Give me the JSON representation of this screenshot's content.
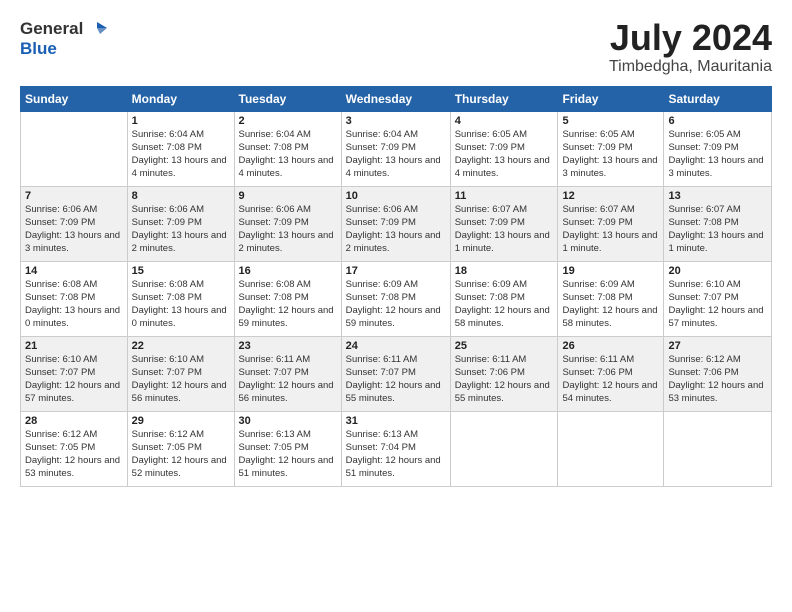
{
  "header": {
    "logo_general": "General",
    "logo_blue": "Blue",
    "month": "July 2024",
    "location": "Timbedgha, Mauritania"
  },
  "weekdays": [
    "Sunday",
    "Monday",
    "Tuesday",
    "Wednesday",
    "Thursday",
    "Friday",
    "Saturday"
  ],
  "weeks": [
    [
      {
        "day": "",
        "sunrise": "",
        "sunset": "",
        "daylight": ""
      },
      {
        "day": "1",
        "sunrise": "6:04 AM",
        "sunset": "7:08 PM",
        "daylight": "13 hours and 4 minutes."
      },
      {
        "day": "2",
        "sunrise": "6:04 AM",
        "sunset": "7:08 PM",
        "daylight": "13 hours and 4 minutes."
      },
      {
        "day": "3",
        "sunrise": "6:04 AM",
        "sunset": "7:09 PM",
        "daylight": "13 hours and 4 minutes."
      },
      {
        "day": "4",
        "sunrise": "6:05 AM",
        "sunset": "7:09 PM",
        "daylight": "13 hours and 4 minutes."
      },
      {
        "day": "5",
        "sunrise": "6:05 AM",
        "sunset": "7:09 PM",
        "daylight": "13 hours and 3 minutes."
      },
      {
        "day": "6",
        "sunrise": "6:05 AM",
        "sunset": "7:09 PM",
        "daylight": "13 hours and 3 minutes."
      }
    ],
    [
      {
        "day": "7",
        "sunrise": "6:06 AM",
        "sunset": "7:09 PM",
        "daylight": "13 hours and 3 minutes."
      },
      {
        "day": "8",
        "sunrise": "6:06 AM",
        "sunset": "7:09 PM",
        "daylight": "13 hours and 2 minutes."
      },
      {
        "day": "9",
        "sunrise": "6:06 AM",
        "sunset": "7:09 PM",
        "daylight": "13 hours and 2 minutes."
      },
      {
        "day": "10",
        "sunrise": "6:06 AM",
        "sunset": "7:09 PM",
        "daylight": "13 hours and 2 minutes."
      },
      {
        "day": "11",
        "sunrise": "6:07 AM",
        "sunset": "7:09 PM",
        "daylight": "13 hours and 1 minute."
      },
      {
        "day": "12",
        "sunrise": "6:07 AM",
        "sunset": "7:09 PM",
        "daylight": "13 hours and 1 minute."
      },
      {
        "day": "13",
        "sunrise": "6:07 AM",
        "sunset": "7:08 PM",
        "daylight": "13 hours and 1 minute."
      }
    ],
    [
      {
        "day": "14",
        "sunrise": "6:08 AM",
        "sunset": "7:08 PM",
        "daylight": "13 hours and 0 minutes."
      },
      {
        "day": "15",
        "sunrise": "6:08 AM",
        "sunset": "7:08 PM",
        "daylight": "13 hours and 0 minutes."
      },
      {
        "day": "16",
        "sunrise": "6:08 AM",
        "sunset": "7:08 PM",
        "daylight": "12 hours and 59 minutes."
      },
      {
        "day": "17",
        "sunrise": "6:09 AM",
        "sunset": "7:08 PM",
        "daylight": "12 hours and 59 minutes."
      },
      {
        "day": "18",
        "sunrise": "6:09 AM",
        "sunset": "7:08 PM",
        "daylight": "12 hours and 58 minutes."
      },
      {
        "day": "19",
        "sunrise": "6:09 AM",
        "sunset": "7:08 PM",
        "daylight": "12 hours and 58 minutes."
      },
      {
        "day": "20",
        "sunrise": "6:10 AM",
        "sunset": "7:07 PM",
        "daylight": "12 hours and 57 minutes."
      }
    ],
    [
      {
        "day": "21",
        "sunrise": "6:10 AM",
        "sunset": "7:07 PM",
        "daylight": "12 hours and 57 minutes."
      },
      {
        "day": "22",
        "sunrise": "6:10 AM",
        "sunset": "7:07 PM",
        "daylight": "12 hours and 56 minutes."
      },
      {
        "day": "23",
        "sunrise": "6:11 AM",
        "sunset": "7:07 PM",
        "daylight": "12 hours and 56 minutes."
      },
      {
        "day": "24",
        "sunrise": "6:11 AM",
        "sunset": "7:07 PM",
        "daylight": "12 hours and 55 minutes."
      },
      {
        "day": "25",
        "sunrise": "6:11 AM",
        "sunset": "7:06 PM",
        "daylight": "12 hours and 55 minutes."
      },
      {
        "day": "26",
        "sunrise": "6:11 AM",
        "sunset": "7:06 PM",
        "daylight": "12 hours and 54 minutes."
      },
      {
        "day": "27",
        "sunrise": "6:12 AM",
        "sunset": "7:06 PM",
        "daylight": "12 hours and 53 minutes."
      }
    ],
    [
      {
        "day": "28",
        "sunrise": "6:12 AM",
        "sunset": "7:05 PM",
        "daylight": "12 hours and 53 minutes."
      },
      {
        "day": "29",
        "sunrise": "6:12 AM",
        "sunset": "7:05 PM",
        "daylight": "12 hours and 52 minutes."
      },
      {
        "day": "30",
        "sunrise": "6:13 AM",
        "sunset": "7:05 PM",
        "daylight": "12 hours and 51 minutes."
      },
      {
        "day": "31",
        "sunrise": "6:13 AM",
        "sunset": "7:04 PM",
        "daylight": "12 hours and 51 minutes."
      },
      {
        "day": "",
        "sunrise": "",
        "sunset": "",
        "daylight": ""
      },
      {
        "day": "",
        "sunrise": "",
        "sunset": "",
        "daylight": ""
      },
      {
        "day": "",
        "sunrise": "",
        "sunset": "",
        "daylight": ""
      }
    ]
  ]
}
